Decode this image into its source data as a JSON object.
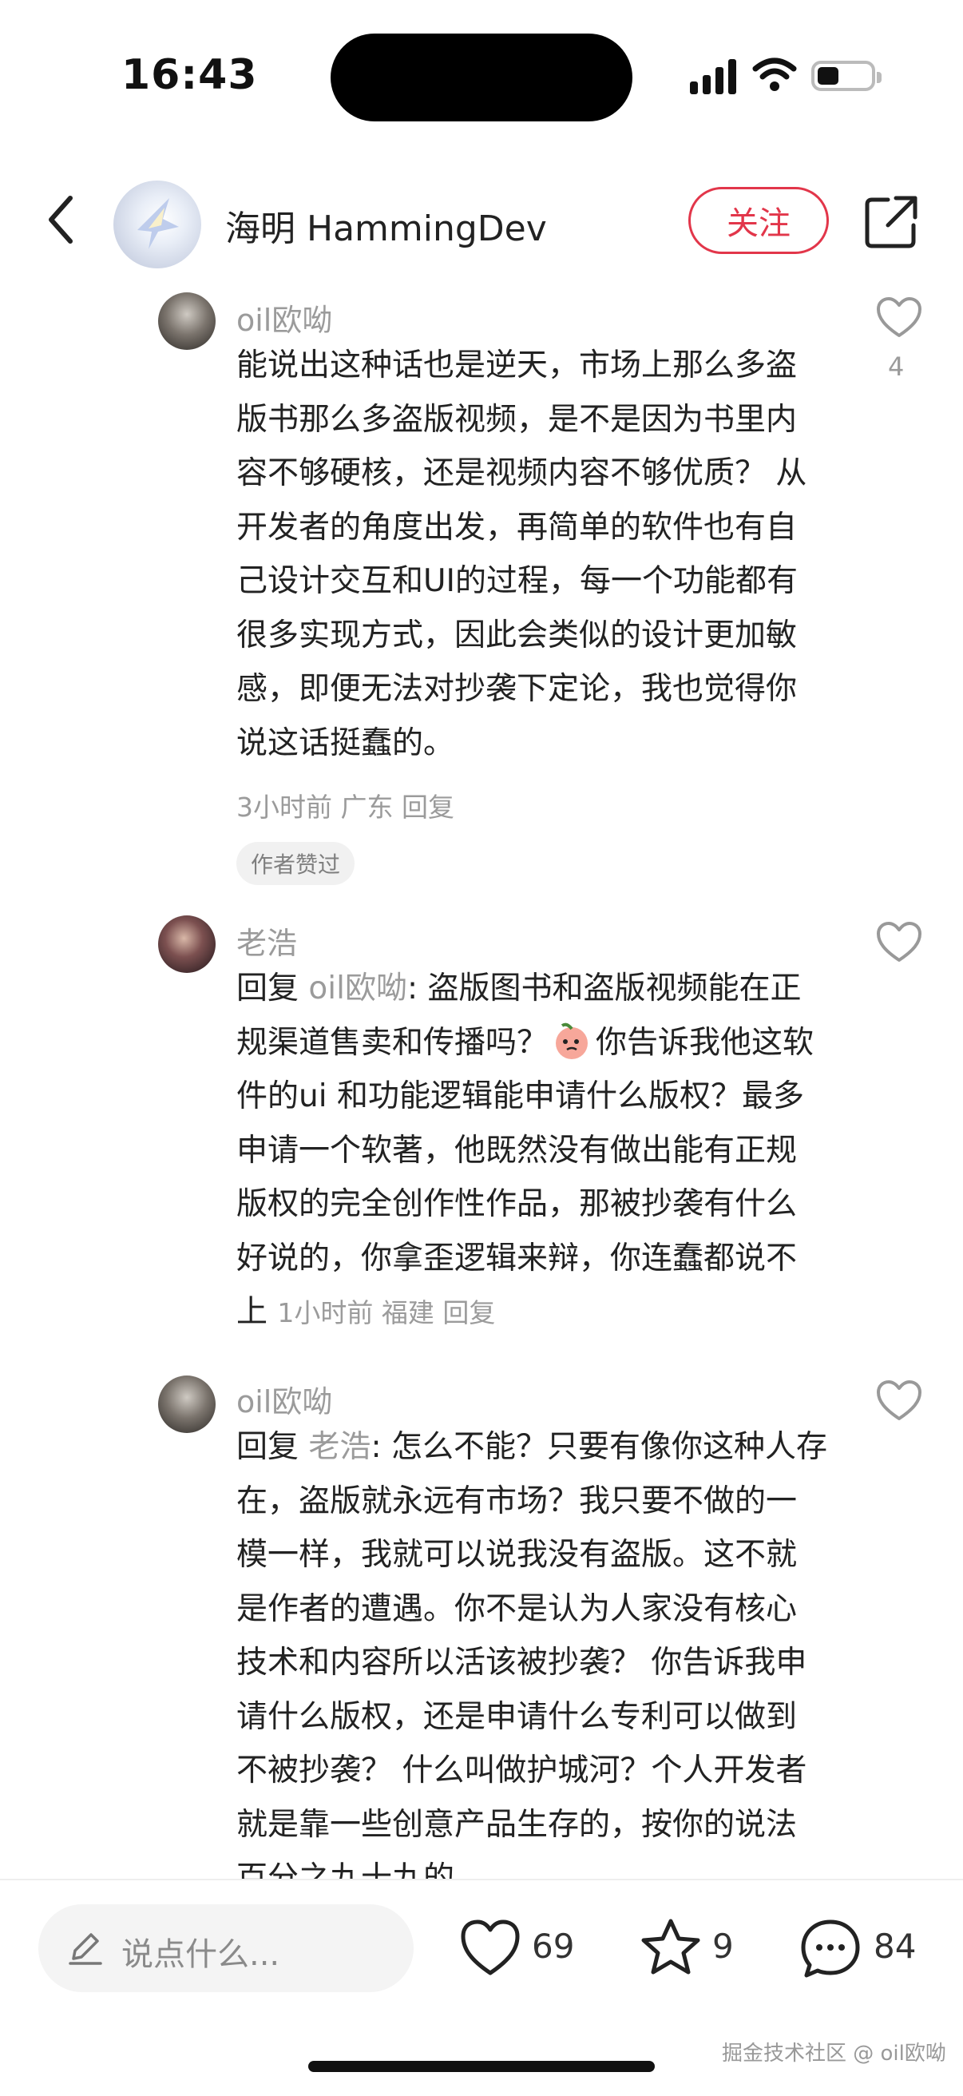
{
  "status": {
    "time": "16:43"
  },
  "header": {
    "author_name": "海明 HammingDev",
    "follow_label": "关注"
  },
  "comments": [
    {
      "user": "oil欧呦",
      "text": "能说出这种话也是逆天，市场上那么多盗版书那么多盗版视频，是不是因为书里内容不够硬核，还是视频内容不够优质？ 从开发者的角度出发，再简单的软件也有自己设计交互和UI的过程，每一个功能都有很多实现方式，因此会类似的设计更加敏感，即便无法对抄袭下定论，我也觉得你说这话挺蠢的。",
      "meta": "3小时前 广东 回复",
      "badge": "作者赞过",
      "likes": "4"
    },
    {
      "user": "老浩",
      "reply_prefix": "回复",
      "reply_to": "oil欧呦",
      "text_before_emoji": ": 盗版图书和盗版视频能在正规渠道售卖和传播吗？",
      "text_after_emoji": "你告诉我他这软件的ui 和功能逻辑能申请什么版权？最多申请一个软著，他既然没有做出能有正规版权的完全创作性作品，那被抄袭有什么好说的，你拿歪逻辑来辩，你连蠢都说不上",
      "meta": "1小时前 福建 回复"
    },
    {
      "user": "oil欧呦",
      "reply_prefix": "回复",
      "reply_to": "老浩",
      "text": ": 怎么不能？只要有像你这种人存在，盗版就永远有市场？我只要不做的一模一样，我就可以说我没有盗版。这不就是作者的遭遇。你不是认为人家没有核心技术和内容所以活该被抄袭？ 你告诉我申请什么版权，还是申请什么专利可以做到不被抄袭？ 什么叫做护城河？个人开发者就是靠一些创意产品生存的，按你的说法百分之九十九的"
    }
  ],
  "bottom_bar": {
    "input_placeholder": "说点什么...",
    "like_count": "69",
    "collect_count": "9",
    "comment_count": "84"
  },
  "watermark": "掘金技术社区 @ oil欧呦",
  "colors": {
    "accent": "#e2364a",
    "muted": "#9b9b9b"
  }
}
